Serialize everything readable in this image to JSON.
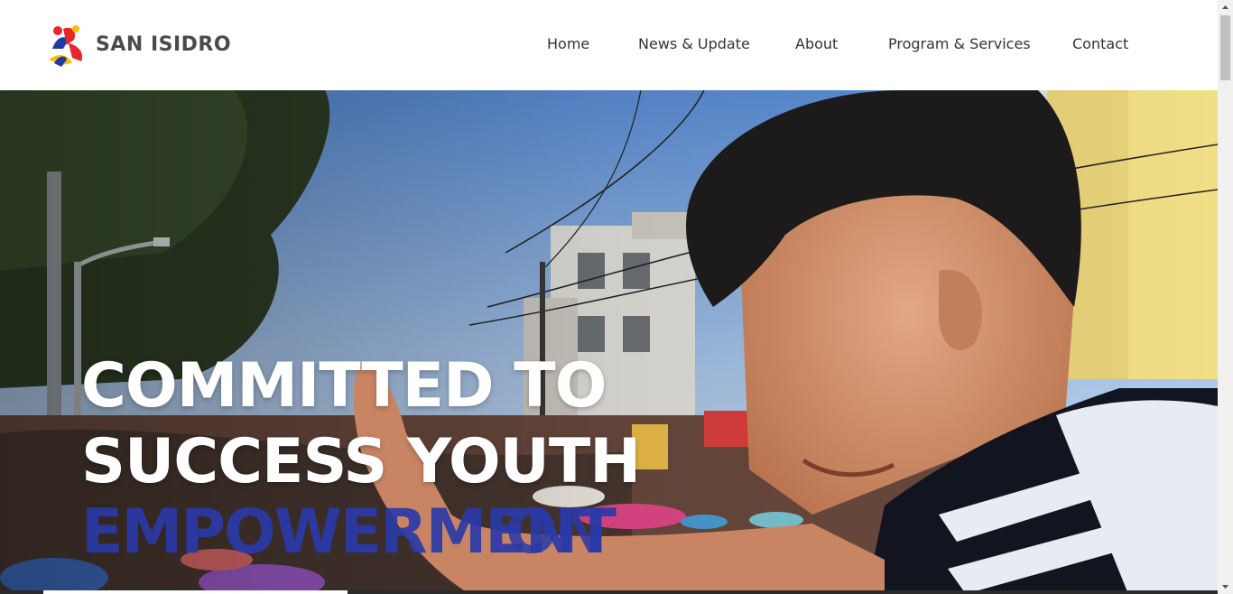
{
  "brand": {
    "name": "SAN ISIDRO",
    "logo_icon": "san-isidro-logo-icon",
    "colors": {
      "red": "#e8262b",
      "blue": "#1f3aa8",
      "yellow": "#f6c100",
      "text": "#4a4a4a"
    }
  },
  "nav": {
    "items": [
      {
        "label": "Home"
      },
      {
        "label": "News & Update"
      },
      {
        "label": "About"
      },
      {
        "label": "Program & Services"
      },
      {
        "label": "Contact"
      }
    ]
  },
  "hero": {
    "title_line1": "COMMITTED TO",
    "title_line2": "SUCCESS YOUTH",
    "accent_word": "EMPOWERMENT",
    "accent_trailing": "ON",
    "accent_color": "#2a3aa8"
  },
  "slider": {
    "progress": 0.25
  }
}
